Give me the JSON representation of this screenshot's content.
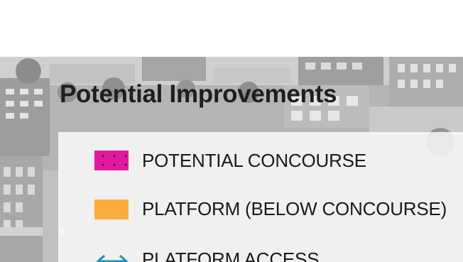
{
  "title": "Potential Improvements",
  "legend": {
    "items": [
      {
        "label": "POTENTIAL CONCOURSE",
        "icon": "magenta-dotted-swatch",
        "color": "#e0199e"
      },
      {
        "label": "PLATFORM (BELOW CONCOURSE)",
        "icon": "orange-swatch",
        "color": "#fbad3c"
      },
      {
        "label": "PLATFORM ACCESS",
        "icon": "double-arrow-icon",
        "color": "#1f8fb8"
      }
    ]
  },
  "colors": {
    "background_tone": "#b9b9b9",
    "panel": "#ffffff"
  }
}
